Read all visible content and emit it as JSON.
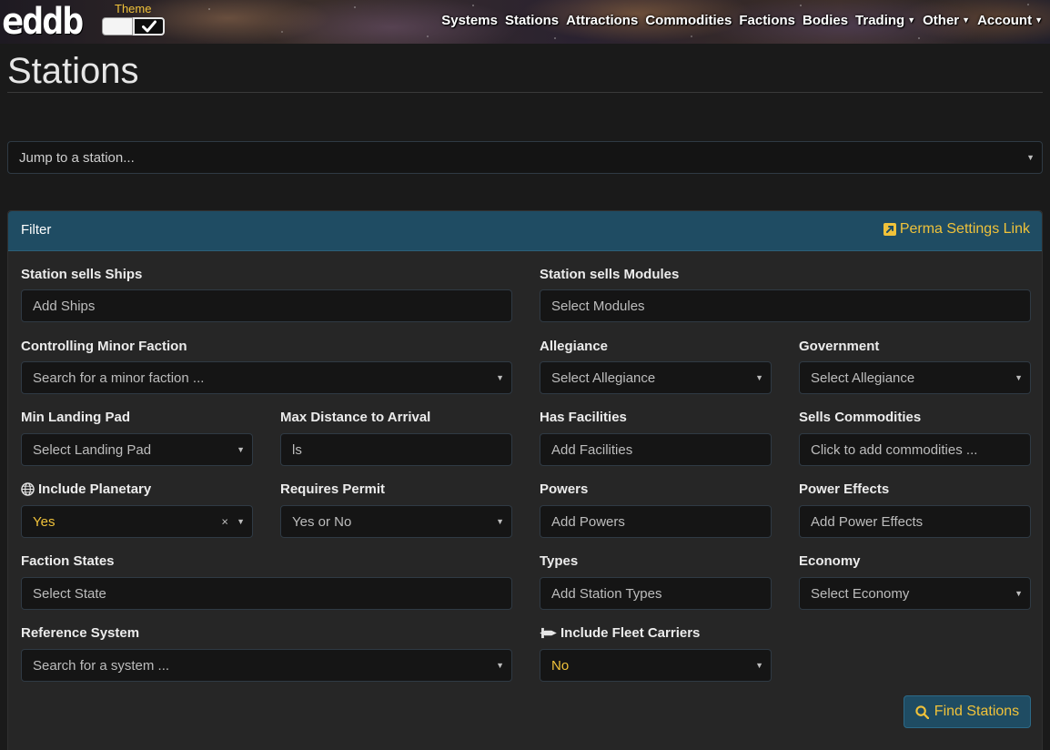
{
  "brand": {
    "logo_text": "eddb",
    "theme_label": "Theme"
  },
  "nav": {
    "items": [
      {
        "label": "Systems",
        "dropdown": false
      },
      {
        "label": "Stations",
        "dropdown": false
      },
      {
        "label": "Attractions",
        "dropdown": false
      },
      {
        "label": "Commodities",
        "dropdown": false
      },
      {
        "label": "Factions",
        "dropdown": false
      },
      {
        "label": "Bodies",
        "dropdown": false
      },
      {
        "label": "Trading",
        "dropdown": true
      },
      {
        "label": "Other",
        "dropdown": true
      },
      {
        "label": "Account",
        "dropdown": true
      }
    ]
  },
  "page": {
    "title": "Stations"
  },
  "jump": {
    "placeholder": "Jump to a station..."
  },
  "filter": {
    "header": "Filter",
    "perma_link": "Perma Settings Link",
    "fields": {
      "ships": {
        "label": "Station sells Ships",
        "value": "Add Ships"
      },
      "modules": {
        "label": "Station sells Modules",
        "value": "Select Modules"
      },
      "faction": {
        "label": "Controlling Minor Faction",
        "value": "Search for a minor faction ..."
      },
      "allegiance": {
        "label": "Allegiance",
        "value": "Select Allegiance"
      },
      "government": {
        "label": "Government",
        "value": "Select Allegiance"
      },
      "landing_pad": {
        "label": "Min Landing Pad",
        "value": "Select Landing Pad"
      },
      "max_distance": {
        "label": "Max Distance to Arrival",
        "value": "ls"
      },
      "facilities": {
        "label": "Has Facilities",
        "value": "Add Facilities"
      },
      "commodities": {
        "label": "Sells Commodities",
        "value": "Click to add commodities ..."
      },
      "planetary": {
        "label": "Include Planetary",
        "value": "Yes",
        "clear": "×"
      },
      "permit": {
        "label": "Requires Permit",
        "value": "Yes or No"
      },
      "powers": {
        "label": "Powers",
        "value": "Add Powers"
      },
      "power_effects": {
        "label": "Power Effects",
        "value": "Add Power Effects"
      },
      "faction_states": {
        "label": "Faction States",
        "value": "Select State"
      },
      "types": {
        "label": "Types",
        "value": "Add Station Types"
      },
      "economy": {
        "label": "Economy",
        "value": "Select Economy"
      },
      "reference_system": {
        "label": "Reference System",
        "value": "Search for a system ..."
      },
      "fleet_carriers": {
        "label": "Include Fleet Carriers",
        "value": "No"
      }
    },
    "submit": "Find Stations"
  },
  "icons": {
    "theme_check": "check-icon",
    "perma": "external-link-icon",
    "planetary": "globe-icon",
    "fleet": "fleet-carrier-icon",
    "submit": "search-icon",
    "dropdown": "caret-down-icon"
  },
  "colors": {
    "accent": "#f0c23a",
    "header_bg": "#1f4c63",
    "page_bg": "#1a1a1a",
    "card_bg": "#262626"
  }
}
